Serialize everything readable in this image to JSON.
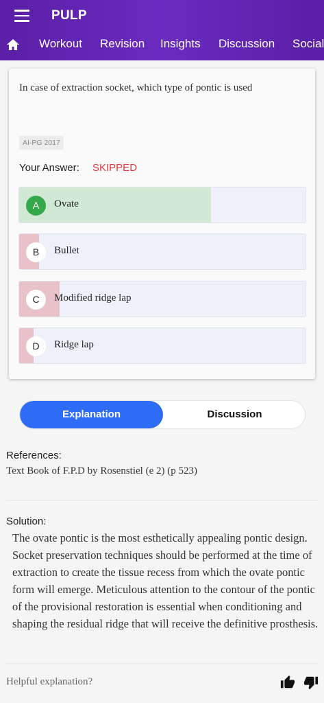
{
  "app": {
    "title": "PULP"
  },
  "nav": {
    "menu_icon": "hamburger-menu-icon",
    "home_icon": "home-icon",
    "tabs": [
      {
        "label": "Workout"
      },
      {
        "label": "Revision"
      },
      {
        "label": "Insights"
      },
      {
        "label": "Discussion"
      },
      {
        "label": "Social"
      }
    ]
  },
  "question": {
    "text": "In case of extraction socket, which type of pontic is used",
    "tag": "AI-PG 2017",
    "answer_label": "Your Answer:",
    "answer_value": "SKIPPED",
    "options": [
      {
        "letter": "A",
        "text": "Ovate",
        "correct": true,
        "share": 0.67
      },
      {
        "letter": "B",
        "text": "Bullet",
        "correct": false,
        "share": 0.07
      },
      {
        "letter": "C",
        "text": "Modified ridge lap",
        "correct": false,
        "share": 0.14
      },
      {
        "letter": "D",
        "text": "Ridge lap",
        "correct": false,
        "share": 0.05
      }
    ]
  },
  "tabs": {
    "explanation": "Explanation",
    "discussion": "Discussion",
    "active": "explanation"
  },
  "references": {
    "heading": "References:",
    "text": "Text Book of F.P.D by Rosenstiel (e 2) (p 523)"
  },
  "solution": {
    "heading": "Solution:",
    "text": "The ovate pontic is the most esthetically appealing pontic design. Socket preservation techniques should be performed at the time of extraction to create the tissue recess from which the ovate pontic form will emerge. Meticulous attention to the contour of the pontic of the provisional restoration is essential when conditioning and shaping the residual ridge that will receive the definitive prosthesis."
  },
  "feedback": {
    "prompt": "Helpful explanation?",
    "up_icon": "thumbs-up-icon",
    "down_icon": "thumbs-down-icon"
  },
  "colors": {
    "header": "#5b1fa6",
    "correct_fill": "#d0e8d4",
    "wrong_fill": "#e8c2c8",
    "correct_circle": "#35a84a",
    "skipped": "#e0393e",
    "active_tab": "#2f6cf6"
  }
}
